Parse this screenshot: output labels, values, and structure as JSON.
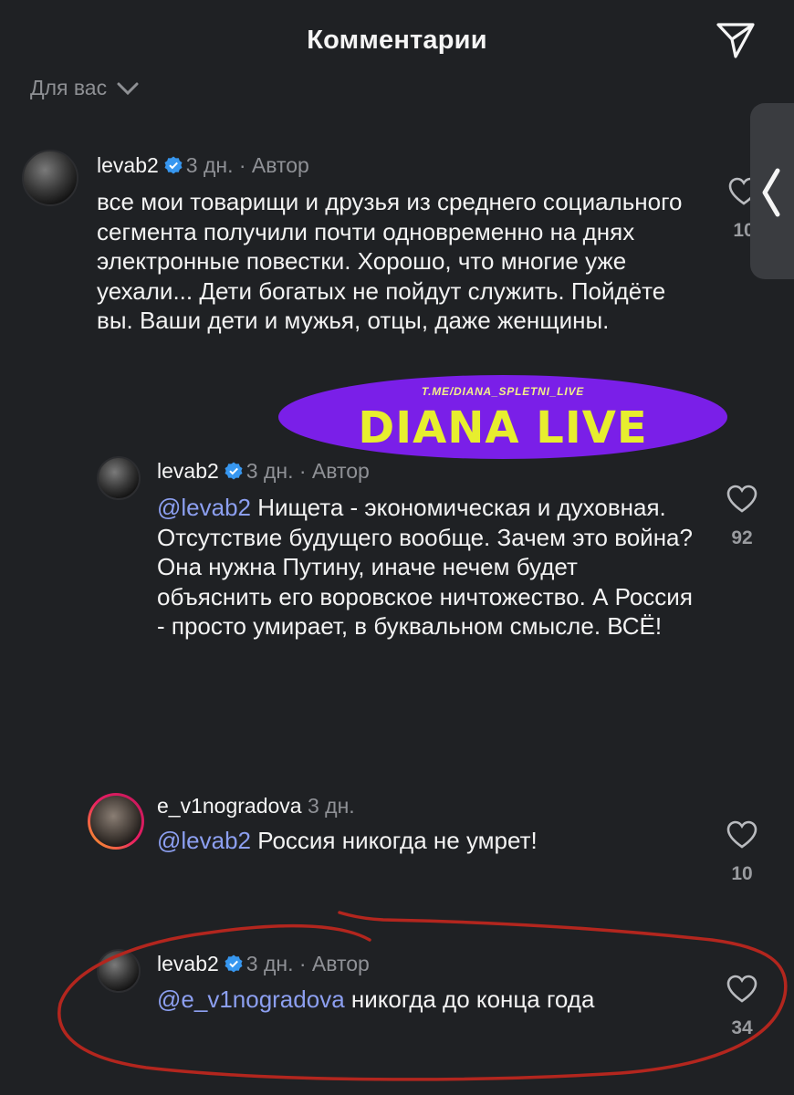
{
  "header": {
    "title": "Комментарии"
  },
  "filter": {
    "label": "Для вас"
  },
  "comments": [
    {
      "user": "levab2",
      "time": "3 дн.",
      "author_tag": "· Автор",
      "text": "все мои товарищи и друзья из среднего социального сегмента получили почти одновременно на днях электронные повестки. Хорошо, что многие уже уехали... Дети богатых не пойдут служить. Пойдёте вы. Ваши дети и мужья, отцы, даже женщины.",
      "likes": "10"
    },
    {
      "user": "levab2",
      "time": "3 дн.",
      "author_tag": "· Автор",
      "mention": "@levab2",
      "text": " Нищета - экономическая и духовная. Отсутствие будущего вообще. Зачем это война? Она нужна Путину, иначе нечем будет объяснить его воровское ничтожество. А Россия - просто умирает, в буквальном смысле. ВСЁ!",
      "likes": "92"
    },
    {
      "user": "e_v1nogradova",
      "time": "3 дн.",
      "mention": "@levab2",
      "text": " Россия  никогда не умрет!",
      "likes": "10"
    },
    {
      "user": "levab2",
      "time": "3 дн.",
      "author_tag": "· Автор",
      "mention": "@e_v1nogradova",
      "text": " никогда до конца года",
      "likes": "34"
    }
  ],
  "watermark": {
    "small": "T.ME/DIANA_SPLETNI_LIVE",
    "big": "DIANA LIVE"
  },
  "icons": {
    "share": "paper-plane-icon",
    "filter": "chevron-down-icon",
    "verified": "verified-badge-icon",
    "like": "heart-icon",
    "handle": "chevron-left-icon"
  },
  "colors": {
    "background": "#1f2124",
    "mention": "#8c9ff0",
    "verified": "#3797f0",
    "watermark_bg": "#7a1fe8",
    "annotation": "#b3261e"
  }
}
